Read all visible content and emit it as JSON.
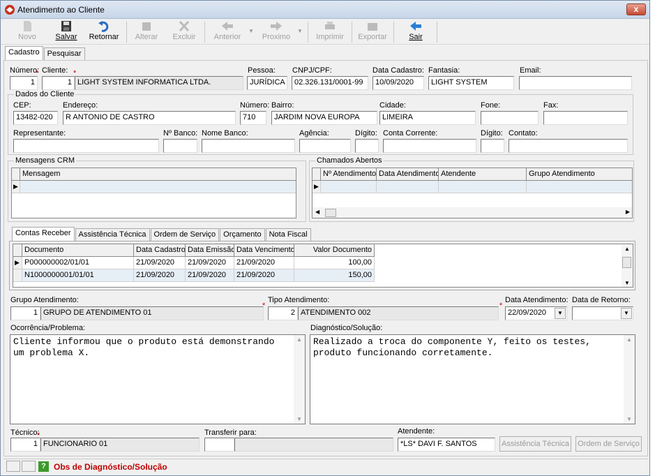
{
  "window": {
    "title": "Atendimento ao Cliente",
    "close": "x"
  },
  "toolbar": {
    "novo": "Novo",
    "salvar": "Salvar",
    "retornar": "Retornar",
    "alterar": "Alterar",
    "excluir": "Excluir",
    "anterior": "Anterior",
    "proximo": "Proximo",
    "imprimir": "Imprimir",
    "exportar": "Exportar",
    "sair": "Sair"
  },
  "main_tabs": [
    "Cadastro",
    "Pesquisar"
  ],
  "header": {
    "numero_label": "Número:",
    "numero": "1",
    "cliente_label": "Cliente:",
    "cliente_cod": "1",
    "cliente_nome": "LIGHT SYSTEM INFORMATICA LTDA.",
    "pessoa_label": "Pessoa:",
    "pessoa": "JURÍDICA",
    "cnpj_label": "CNPJ/CPF:",
    "cnpj": "02.326.131/0001-99",
    "data_cad_label": "Data Cadastro:",
    "data_cad": "10/09/2020",
    "fantasia_label": "Fantasia:",
    "fantasia": "LIGHT SYSTEM",
    "email_label": "Email:",
    "email": ""
  },
  "dados": {
    "title": "Dados do Cliente",
    "cep_label": "CEP:",
    "cep": "13482-020",
    "endereco_label": "Endereço:",
    "endereco": "R ANTONIO DE CASTRO",
    "numero_label": "Número:",
    "numero": "710",
    "bairro_label": "Bairro:",
    "bairro": "JARDIM NOVA EUROPA",
    "cidade_label": "Cidade:",
    "cidade": "LIMEIRA",
    "fone_label": "Fone:",
    "fone": "",
    "fax_label": "Fax:",
    "fax": "",
    "rep_label": "Representante:",
    "nbanco_label": "Nº Banco:",
    "nomebanco_label": "Nome Banco:",
    "agencia_label": "Agência:",
    "digito_label": "Dígito:",
    "cc_label": "Conta Corrente:",
    "digito2_label": "Dígito:",
    "contato_label": "Contato:"
  },
  "crm": {
    "title": "Mensagens CRM",
    "col": "Mensagem"
  },
  "chamados": {
    "title": "Chamados Abertos",
    "cols": [
      "Nº Atendimento",
      "Data Atendimento",
      "Atendente",
      "Grupo Atendimento"
    ]
  },
  "sub_tabs": [
    "Contas Receber",
    "Assistência Técnica",
    "Ordem de Serviço",
    "Orçamento",
    "Nota Fiscal"
  ],
  "contas": {
    "cols": [
      "Documento",
      "Data Cadastro",
      "Data Emissão",
      "Data Vencimento",
      "Valor Documento"
    ],
    "rows": [
      [
        "P000000002/01/01",
        "21/09/2020",
        "21/09/2020",
        "21/09/2020",
        "100,00"
      ],
      [
        "N1000000001/01/01",
        "21/09/2020",
        "21/09/2020",
        "21/09/2020",
        "150,00"
      ]
    ]
  },
  "atend": {
    "grupo_label": "Grupo Atendimento:",
    "grupo_cod": "1",
    "grupo": "GRUPO DE ATENDIMENTO 01",
    "tipo_label": "Tipo Atendimento:",
    "tipo_cod": "2",
    "tipo": "ATENDIMENTO 002",
    "data_label": "Data Atendimento:",
    "data": "22/09/2020",
    "retorno_label": "Data de Retorno:",
    "retorno": ""
  },
  "ocorrencia": {
    "label": "Ocorrência/Problema:",
    "text": "Cliente informou que o produto está demonstrando\num problema X."
  },
  "diagnostico": {
    "label": "Diagnóstico/Solução:",
    "text": "Realizado a troca do componente Y, feito os testes,\nproduto funcionando corretamente."
  },
  "footer": {
    "tecnico_label": "Técnico:",
    "tecnico_cod": "1",
    "tecnico": "FUNCIONARIO 01",
    "transf_label": "Transferir para:",
    "atendente_label": "Atendente:",
    "atendente": "*LS* DAVI F. SANTOS",
    "btn_assist": "Assistência Técnica",
    "btn_os": "Ordem de Serviço"
  },
  "status": {
    "text": "Obs de Diagnóstico/Solução",
    "color": "#c00000"
  }
}
